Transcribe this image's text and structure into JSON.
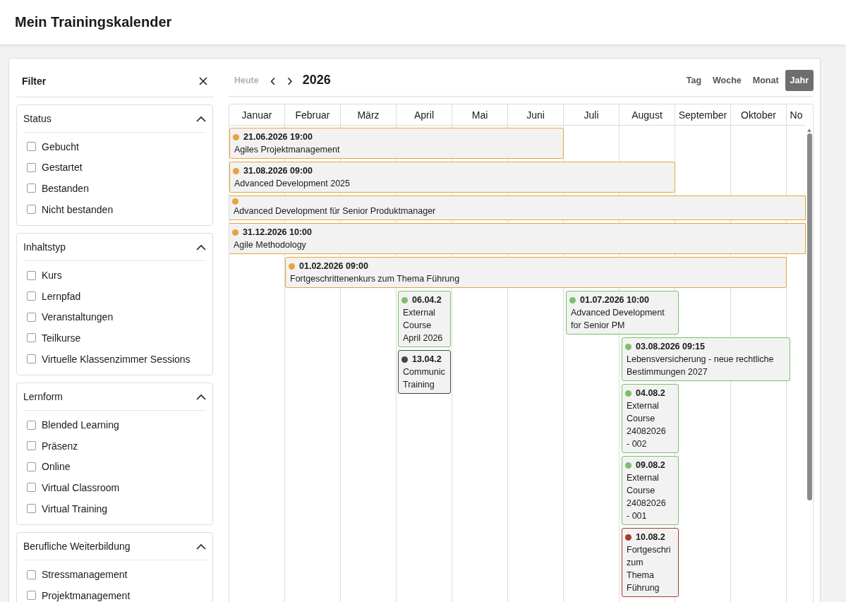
{
  "header": {
    "title": "Mein Trainingskalender"
  },
  "filter": {
    "title": "Filter",
    "sections": [
      {
        "title": "Status",
        "expanded": true,
        "options": [
          {
            "label": "Gebucht",
            "checked": false
          },
          {
            "label": "Gestartet",
            "checked": false
          },
          {
            "label": "Bestanden",
            "checked": false
          },
          {
            "label": "Nicht bestanden",
            "checked": false
          }
        ]
      },
      {
        "title": "Inhaltstyp",
        "expanded": true,
        "options": [
          {
            "label": "Kurs",
            "checked": false
          },
          {
            "label": "Lernpfad",
            "checked": false
          },
          {
            "label": "Veranstaltungen",
            "checked": false
          },
          {
            "label": "Teilkurse",
            "checked": false
          },
          {
            "label": "Virtuelle Klassenzimmer Sessions",
            "checked": false
          }
        ]
      },
      {
        "title": "Lernform",
        "expanded": true,
        "options": [
          {
            "label": "Blended Learning",
            "checked": false
          },
          {
            "label": "Präsenz",
            "checked": false
          },
          {
            "label": "Online",
            "checked": false
          },
          {
            "label": "Virtual Classroom",
            "checked": false
          },
          {
            "label": "Virtual Training",
            "checked": false
          }
        ]
      },
      {
        "title": "Berufliche Weiterbildung",
        "expanded": true,
        "options": [
          {
            "label": "Stressmanagement",
            "checked": false
          },
          {
            "label": "Projektmanagement",
            "checked": false
          }
        ]
      }
    ]
  },
  "toolbar": {
    "today": {
      "label": "Heute",
      "disabled": true
    },
    "prev": "‹",
    "next": "›",
    "period": "2026",
    "views": [
      {
        "label": "Tag",
        "selected": false
      },
      {
        "label": "Woche",
        "selected": false
      },
      {
        "label": "Monat",
        "selected": false
      },
      {
        "label": "Jahr",
        "selected": true
      }
    ]
  },
  "months": [
    "Januar",
    "Februar",
    "März",
    "April",
    "Mai",
    "Juni",
    "Juli",
    "August",
    "September",
    "Oktober",
    "No"
  ],
  "events": [
    {
      "time": "21.06.2026 19:00",
      "title": "Agiles Projektmanagement",
      "color": "#e8a33d"
    },
    {
      "time": "31.08.2026 09:00",
      "title": "Advanced Development 2025",
      "color": "#e8a33d"
    },
    {
      "title": "Advanced Development für Senior Produktmanager",
      "color": "#e8a33d"
    },
    {
      "time": "31.12.2026 10:00",
      "title": "Agile Methodology",
      "color": "#e8a33d"
    },
    {
      "time": "01.02.2026 09:00",
      "title": "Fortgeschrittenenkurs zum Thema Führung",
      "color": "#e8a33d"
    },
    {
      "time": "06.04.2",
      "title": "External\nCourse\nApril 2026",
      "color": "#7dbf6b"
    },
    {
      "time": "13.04.2",
      "title": "Communic\nTraining",
      "color": "#444452"
    },
    {
      "time": "01.07.2026 10:00",
      "title": "Advanced Development\nfor Senior PM",
      "color": "#7dbf6b"
    },
    {
      "time": "03.08.2026 09:15",
      "title": "Lebensversicherung - neue rechtliche\nBestimmungen 2027",
      "color": "#7dbf6b"
    },
    {
      "time": "04.08.2",
      "title": "External\nCourse\n24082026\n- 002",
      "color": "#7dbf6b"
    },
    {
      "time": "09.08.2",
      "title": "External\nCourse\n24082026\n- 001",
      "color": "#7dbf6b"
    },
    {
      "time": "10.08.2",
      "title": "Fortgeschri\nzum\nThema\nFührung",
      "color": "#a83a2a"
    }
  ]
}
